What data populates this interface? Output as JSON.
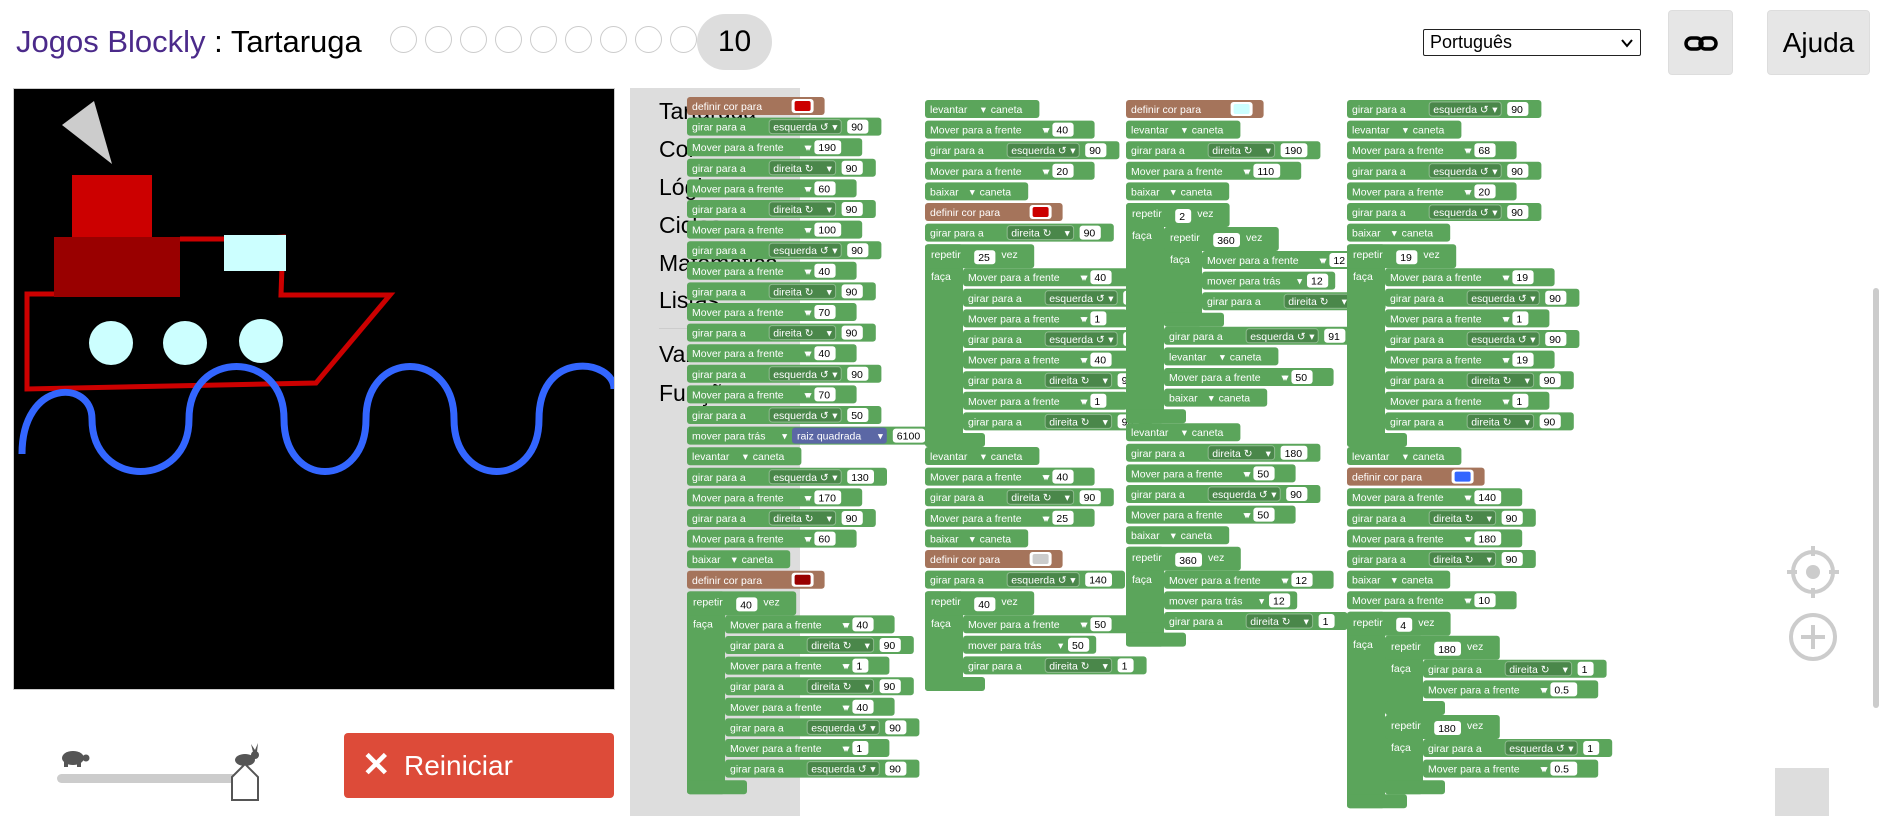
{
  "header": {
    "title_link": "Jogos Blockly",
    "title_sep": " : ",
    "title_page": "Tartaruga",
    "levels": [
      "",
      "",
      "",
      "",
      "",
      "",
      "",
      "",
      ""
    ],
    "current_level": "10",
    "language": "Português",
    "help_label": "Ajuda"
  },
  "controls": {
    "reset_label": "Reiniciar",
    "speed": 1.0
  },
  "toolbox": {
    "categories": [
      "Tartaruga",
      "Cor",
      "Lógica",
      "Ciclos",
      "Matemática",
      "Listas",
      "Variáveis",
      "Funções"
    ]
  },
  "colors": {
    "turtle_block": "#5ba55b",
    "color_block": "#a5745b",
    "math_block": "#5b67a5",
    "red": "#cc0000",
    "dark_red": "#990000",
    "light_cyan": "#ccffff",
    "blue": "#3366ff",
    "grey": "#cccccc",
    "reset": "#dd4b39"
  },
  "scripts": [
    [
      {
        "t": "color",
        "label": "definir cor para",
        "c": "#cc0000"
      },
      {
        "t": "turn",
        "label": "girar para a",
        "dir": "esquerda ↺",
        "v": "90"
      },
      {
        "t": "move",
        "label": "Mover para a frente",
        "v": "190"
      },
      {
        "t": "turn",
        "label": "girar para a",
        "dir": "direita ↻",
        "v": "90"
      },
      {
        "t": "move",
        "label": "Mover para a frente",
        "v": "60"
      },
      {
        "t": "turn",
        "label": "girar para a",
        "dir": "direita ↻",
        "v": "90"
      },
      {
        "t": "move",
        "label": "Mover para a frente",
        "v": "100"
      },
      {
        "t": "turn",
        "label": "girar para a",
        "dir": "esquerda ↺",
        "v": "90"
      },
      {
        "t": "move",
        "label": "Mover para a frente",
        "v": "40"
      },
      {
        "t": "turn",
        "label": "girar para a",
        "dir": "direita ↻",
        "v": "90"
      },
      {
        "t": "move",
        "label": "Mover para a frente",
        "v": "70"
      },
      {
        "t": "turn",
        "label": "girar para a",
        "dir": "direita ↻",
        "v": "90"
      },
      {
        "t": "move",
        "label": "Mover para a frente",
        "v": "40"
      },
      {
        "t": "turn",
        "label": "girar para a",
        "dir": "esquerda ↺",
        "v": "90"
      },
      {
        "t": "move",
        "label": "Mover para a frente",
        "v": "70"
      },
      {
        "t": "turn",
        "label": "girar para a",
        "dir": "esquerda ↺",
        "v": "50"
      },
      {
        "t": "back",
        "label": "mover para trás",
        "fn": "raiz quadrada",
        "v": "6100"
      },
      {
        "t": "pen",
        "label": "levantar",
        "tail": "caneta"
      },
      {
        "t": "turn",
        "label": "girar para a",
        "dir": "esquerda ↺",
        "v": "130"
      },
      {
        "t": "move",
        "label": "Mover para a frente",
        "v": "170"
      },
      {
        "t": "turn",
        "label": "girar para a",
        "dir": "direita ↻",
        "v": "90"
      },
      {
        "t": "move",
        "label": "Mover para a frente",
        "v": "60"
      },
      {
        "t": "pen",
        "label": "baixar",
        "tail": "caneta"
      },
      {
        "t": "color",
        "label": "definir cor para",
        "c": "#990000"
      },
      {
        "t": "repeat",
        "label": "repetir",
        "v": "40",
        "tail": "vez",
        "do": "faça",
        "body": [
          {
            "t": "move",
            "label": "Mover para a frente",
            "v": "40"
          },
          {
            "t": "turn",
            "label": "girar para a",
            "dir": "direita ↻",
            "v": "90"
          },
          {
            "t": "move",
            "label": "Mover para a frente",
            "v": "1"
          },
          {
            "t": "turn",
            "label": "girar para a",
            "dir": "direita ↻",
            "v": "90"
          },
          {
            "t": "move",
            "label": "Mover para a frente",
            "v": "40"
          },
          {
            "t": "turn",
            "label": "girar para a",
            "dir": "esquerda ↺",
            "v": "90"
          },
          {
            "t": "move",
            "label": "Mover para a frente",
            "v": "1"
          },
          {
            "t": "turn",
            "label": "girar para a",
            "dir": "esquerda ↺",
            "v": "90"
          }
        ]
      }
    ],
    [
      {
        "t": "pen",
        "label": "levantar",
        "tail": "caneta"
      },
      {
        "t": "move",
        "label": "Mover para a frente",
        "v": "40"
      },
      {
        "t": "turn",
        "label": "girar para a",
        "dir": "esquerda ↺",
        "v": "90"
      },
      {
        "t": "move",
        "label": "Mover para a frente",
        "v": "20"
      },
      {
        "t": "pen",
        "label": "baixar",
        "tail": "caneta"
      },
      {
        "t": "color",
        "label": "definir cor para",
        "c": "#cc0000"
      },
      {
        "t": "turn",
        "label": "girar para a",
        "dir": "direita ↻",
        "v": "90"
      },
      {
        "t": "repeat",
        "label": "repetir",
        "v": "25",
        "tail": "vez",
        "do": "faça",
        "body": [
          {
            "t": "move",
            "label": "Mover para a frente",
            "v": "40"
          },
          {
            "t": "turn",
            "label": "girar para a",
            "dir": "esquerda ↺",
            "v": "90"
          },
          {
            "t": "move",
            "label": "Mover para a frente",
            "v": "1"
          },
          {
            "t": "turn",
            "label": "girar para a",
            "dir": "esquerda ↺",
            "v": "90"
          },
          {
            "t": "move",
            "label": "Mover para a frente",
            "v": "40"
          },
          {
            "t": "turn",
            "label": "girar para a",
            "dir": "direita ↻",
            "v": "90"
          },
          {
            "t": "move",
            "label": "Mover para a frente",
            "v": "1"
          },
          {
            "t": "turn",
            "label": "girar para a",
            "dir": "direita ↻",
            "v": "90"
          }
        ]
      },
      {
        "t": "pen",
        "label": "levantar",
        "tail": "caneta"
      },
      {
        "t": "move",
        "label": "Mover para a frente",
        "v": "40"
      },
      {
        "t": "turn",
        "label": "girar para a",
        "dir": "direita ↻",
        "v": "90"
      },
      {
        "t": "move",
        "label": "Mover para a frente",
        "v": "25"
      },
      {
        "t": "pen",
        "label": "baixar",
        "tail": "caneta"
      },
      {
        "t": "color",
        "label": "definir cor para",
        "c": "#cccccc"
      },
      {
        "t": "turn",
        "label": "girar para a",
        "dir": "esquerda ↺",
        "v": "140"
      },
      {
        "t": "repeat",
        "label": "repetir",
        "v": "40",
        "tail": "vez",
        "do": "faça",
        "body": [
          {
            "t": "move",
            "label": "Mover para a frente",
            "v": "50"
          },
          {
            "t": "back",
            "label": "mover para trás",
            "v": "50"
          },
          {
            "t": "turn",
            "label": "girar para a",
            "dir": "direita ↻",
            "v": "1"
          }
        ]
      }
    ],
    [
      {
        "t": "color",
        "label": "definir cor para",
        "c": "#ccffff"
      },
      {
        "t": "pen",
        "label": "levantar",
        "tail": "caneta"
      },
      {
        "t": "turn",
        "label": "girar para a",
        "dir": "direita ↻",
        "v": "190"
      },
      {
        "t": "move",
        "label": "Mover para a frente",
        "v": "110"
      },
      {
        "t": "pen",
        "label": "baixar",
        "tail": "caneta"
      },
      {
        "t": "repeat",
        "label": "repetir",
        "v": "2",
        "tail": "vez",
        "do": "faça",
        "body": [
          {
            "t": "repeat",
            "label": "repetir",
            "v": "360",
            "tail": "vez",
            "do": "faça",
            "body": [
              {
                "t": "move",
                "label": "Mover para a frente",
                "v": "12"
              },
              {
                "t": "back",
                "label": "mover para trás",
                "v": "12"
              },
              {
                "t": "turn",
                "label": "girar para a",
                "dir": "direita ↻",
                "v": "1"
              }
            ]
          },
          {
            "t": "turn",
            "label": "girar para a",
            "dir": "esquerda ↺",
            "v": "91"
          },
          {
            "t": "pen",
            "label": "levantar",
            "tail": "caneta"
          },
          {
            "t": "move",
            "label": "Mover para a frente",
            "v": "50"
          },
          {
            "t": "pen",
            "label": "baixar",
            "tail": "caneta"
          }
        ]
      },
      {
        "t": "pen",
        "label": "levantar",
        "tail": "caneta"
      },
      {
        "t": "turn",
        "label": "girar para a",
        "dir": "direita ↻",
        "v": "180"
      },
      {
        "t": "move",
        "label": "Mover para a frente",
        "v": "50"
      },
      {
        "t": "turn",
        "label": "girar para a",
        "dir": "esquerda ↺",
        "v": "90"
      },
      {
        "t": "move",
        "label": "Mover para a frente",
        "v": "50"
      },
      {
        "t": "pen",
        "label": "baixar",
        "tail": "caneta"
      },
      {
        "t": "repeat",
        "label": "repetir",
        "v": "360",
        "tail": "vez",
        "do": "faça",
        "body": [
          {
            "t": "move",
            "label": "Mover para a frente",
            "v": "12"
          },
          {
            "t": "back",
            "label": "mover para trás",
            "v": "12"
          },
          {
            "t": "turn",
            "label": "girar para a",
            "dir": "direita ↻",
            "v": "1"
          }
        ]
      }
    ],
    [
      {
        "t": "turn",
        "label": "girar para a",
        "dir": "esquerda ↺",
        "v": "90"
      },
      {
        "t": "pen",
        "label": "levantar",
        "tail": "caneta"
      },
      {
        "t": "move",
        "label": "Mover para a frente",
        "v": "68"
      },
      {
        "t": "turn",
        "label": "girar para a",
        "dir": "esquerda ↺",
        "v": "90"
      },
      {
        "t": "move",
        "label": "Mover para a frente",
        "v": "20"
      },
      {
        "t": "turn",
        "label": "girar para a",
        "dir": "esquerda ↺",
        "v": "90"
      },
      {
        "t": "pen",
        "label": "baixar",
        "tail": "caneta"
      },
      {
        "t": "repeat",
        "label": "repetir",
        "v": "19",
        "tail": "vez",
        "do": "faça",
        "body": [
          {
            "t": "move",
            "label": "Mover para a frente",
            "v": "19"
          },
          {
            "t": "turn",
            "label": "girar para a",
            "dir": "esquerda ↺",
            "v": "90"
          },
          {
            "t": "move",
            "label": "Mover para a frente",
            "v": "1"
          },
          {
            "t": "turn",
            "label": "girar para a",
            "dir": "esquerda ↺",
            "v": "90"
          },
          {
            "t": "move",
            "label": "Mover para a frente",
            "v": "19"
          },
          {
            "t": "turn",
            "label": "girar para a",
            "dir": "direita ↻",
            "v": "90"
          },
          {
            "t": "move",
            "label": "Mover para a frente",
            "v": "1"
          },
          {
            "t": "turn",
            "label": "girar para a",
            "dir": "direita ↻",
            "v": "90"
          }
        ]
      },
      {
        "t": "pen",
        "label": "levantar",
        "tail": "caneta"
      },
      {
        "t": "color",
        "label": "definir cor para",
        "c": "#3366ff"
      },
      {
        "t": "move",
        "label": "Mover para a frente",
        "v": "140"
      },
      {
        "t": "turn",
        "label": "girar para a",
        "dir": "direita ↻",
        "v": "90"
      },
      {
        "t": "move",
        "label": "Mover para a frente",
        "v": "180"
      },
      {
        "t": "turn",
        "label": "girar para a",
        "dir": "direita ↻",
        "v": "90"
      },
      {
        "t": "pen",
        "label": "baixar",
        "tail": "caneta"
      },
      {
        "t": "move",
        "label": "Mover para a frente",
        "v": "10"
      },
      {
        "t": "repeat",
        "label": "repetir",
        "v": "4",
        "tail": "vez",
        "do": "faça",
        "body": [
          {
            "t": "repeat",
            "label": "repetir",
            "v": "180",
            "tail": "vez",
            "do": "faça",
            "body": [
              {
                "t": "turn",
                "label": "girar para a",
                "dir": "direita ↻",
                "v": "1"
              },
              {
                "t": "move",
                "label": "Mover para a frente",
                "v": "0.5"
              }
            ]
          },
          {
            "t": "repeat",
            "label": "repetir",
            "v": "180",
            "tail": "vez",
            "do": "faça",
            "body": [
              {
                "t": "turn",
                "label": "girar para a",
                "dir": "esquerda ↺",
                "v": "1"
              },
              {
                "t": "move",
                "label": "Mover para a frente",
                "v": "0.5"
              }
            ]
          }
        ]
      }
    ]
  ]
}
